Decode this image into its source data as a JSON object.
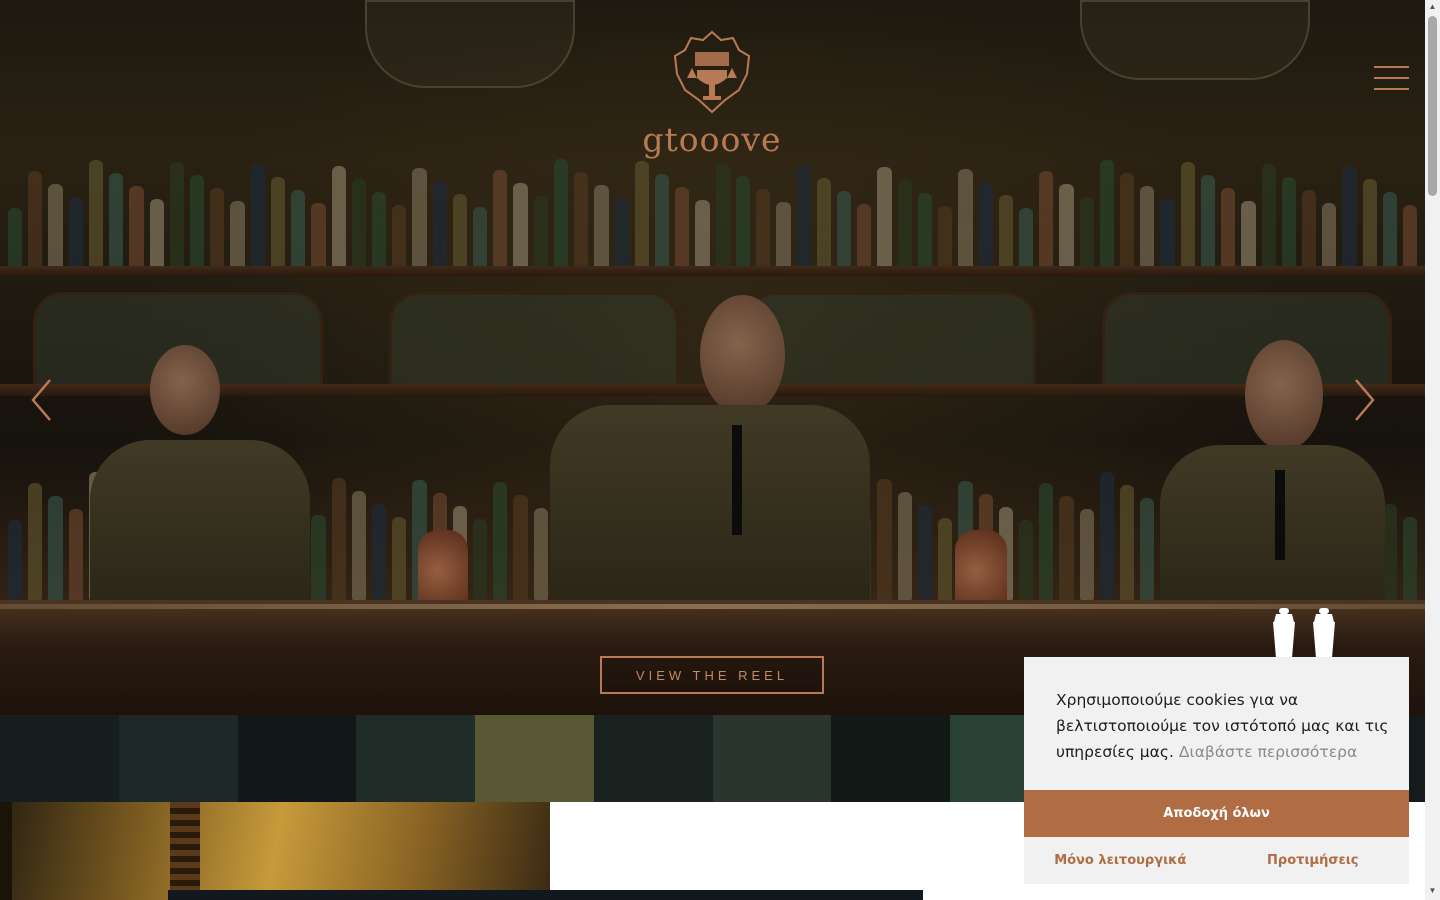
{
  "brand": {
    "name": "gtooove",
    "accent": "#b87a55",
    "button_color": "#b06d44"
  },
  "hero": {
    "cta_label": "VIEW THE REEL",
    "prev_icon": "chevron-left-icon",
    "next_icon": "chevron-right-icon",
    "menu_icon": "hamburger-icon"
  },
  "cookie_banner": {
    "message": "Χρησιμοποιούμε cookies για να βελτιστοποιούμε τον ιστότοπό μας και τις υπηρεσίες μας.",
    "learn_more": "Διαβάστε περισσότερα",
    "accept_all": "Αποδοχή όλων",
    "functional_only": "Μόνο λειτουργικά",
    "preferences": "Προτιμήσεις",
    "icon": "cocktail-shaker-icon"
  }
}
